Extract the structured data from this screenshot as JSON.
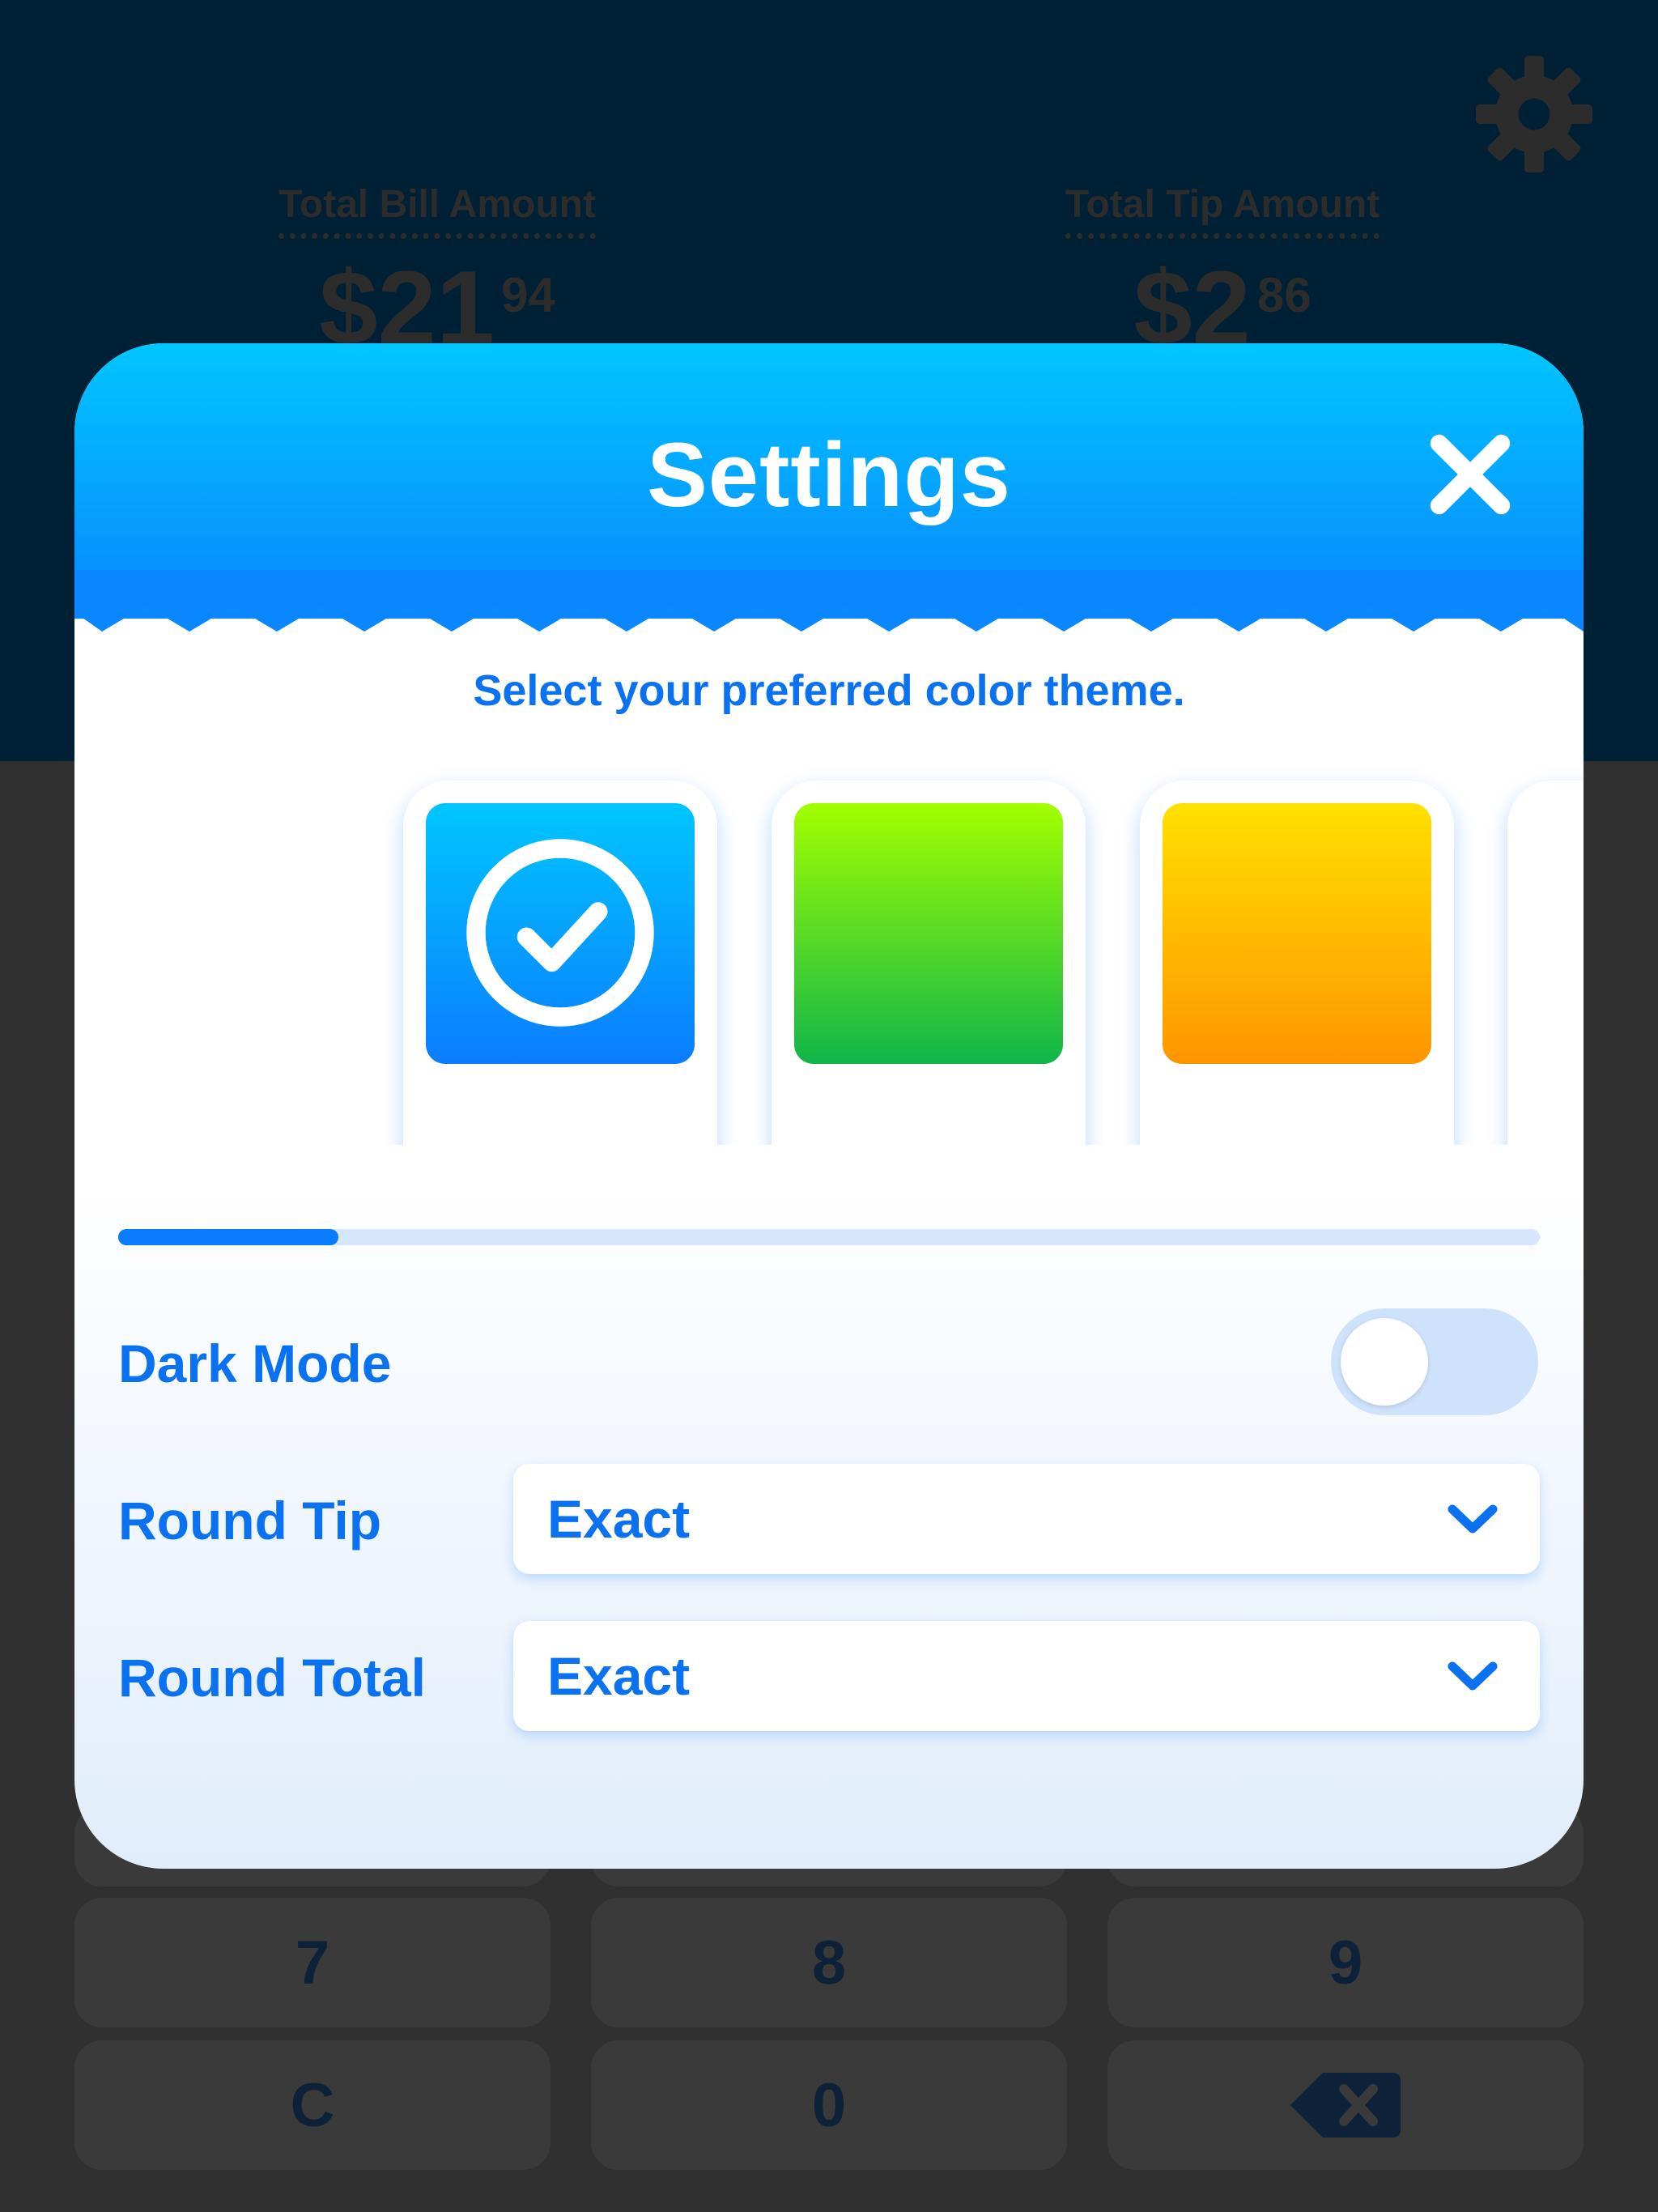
{
  "background_app": {
    "total_bill": {
      "label": "Total Bill Amount",
      "dollars": "$21",
      "cents": "94"
    },
    "total_tip": {
      "label": "Total Tip Amount",
      "dollars": "$2",
      "cents": "86"
    },
    "keypad": {
      "row_789": [
        "7",
        "8",
        "9"
      ],
      "row_bottom": [
        "C",
        "0"
      ],
      "backspace_icon": "backspace-icon"
    },
    "settings_icon": "gear-icon"
  },
  "settings_modal": {
    "title": "Settings",
    "close_icon": "close-icon",
    "theme_prompt": "Select your preferred color theme.",
    "themes": [
      {
        "name": "blue",
        "selected": true,
        "color_top": "#00c6ff",
        "color_bottom": "#0a7dff"
      },
      {
        "name": "green",
        "selected": false,
        "color_top": "#a3ff00",
        "color_bottom": "#10b64a"
      },
      {
        "name": "orange",
        "selected": false,
        "color_top": "#ffe100",
        "color_bottom": "#ff9500"
      }
    ],
    "theme_scroll_position": 0.155,
    "dark_mode": {
      "label": "Dark Mode",
      "enabled": false
    },
    "round_tip": {
      "label": "Round Tip",
      "value": "Exact"
    },
    "round_total": {
      "label": "Round Total",
      "value": "Exact"
    }
  },
  "colors": {
    "accent": "#0a72f0",
    "header_top": "#00c6ff",
    "header_bottom": "#0a86ff",
    "backdrop": "#002035"
  }
}
